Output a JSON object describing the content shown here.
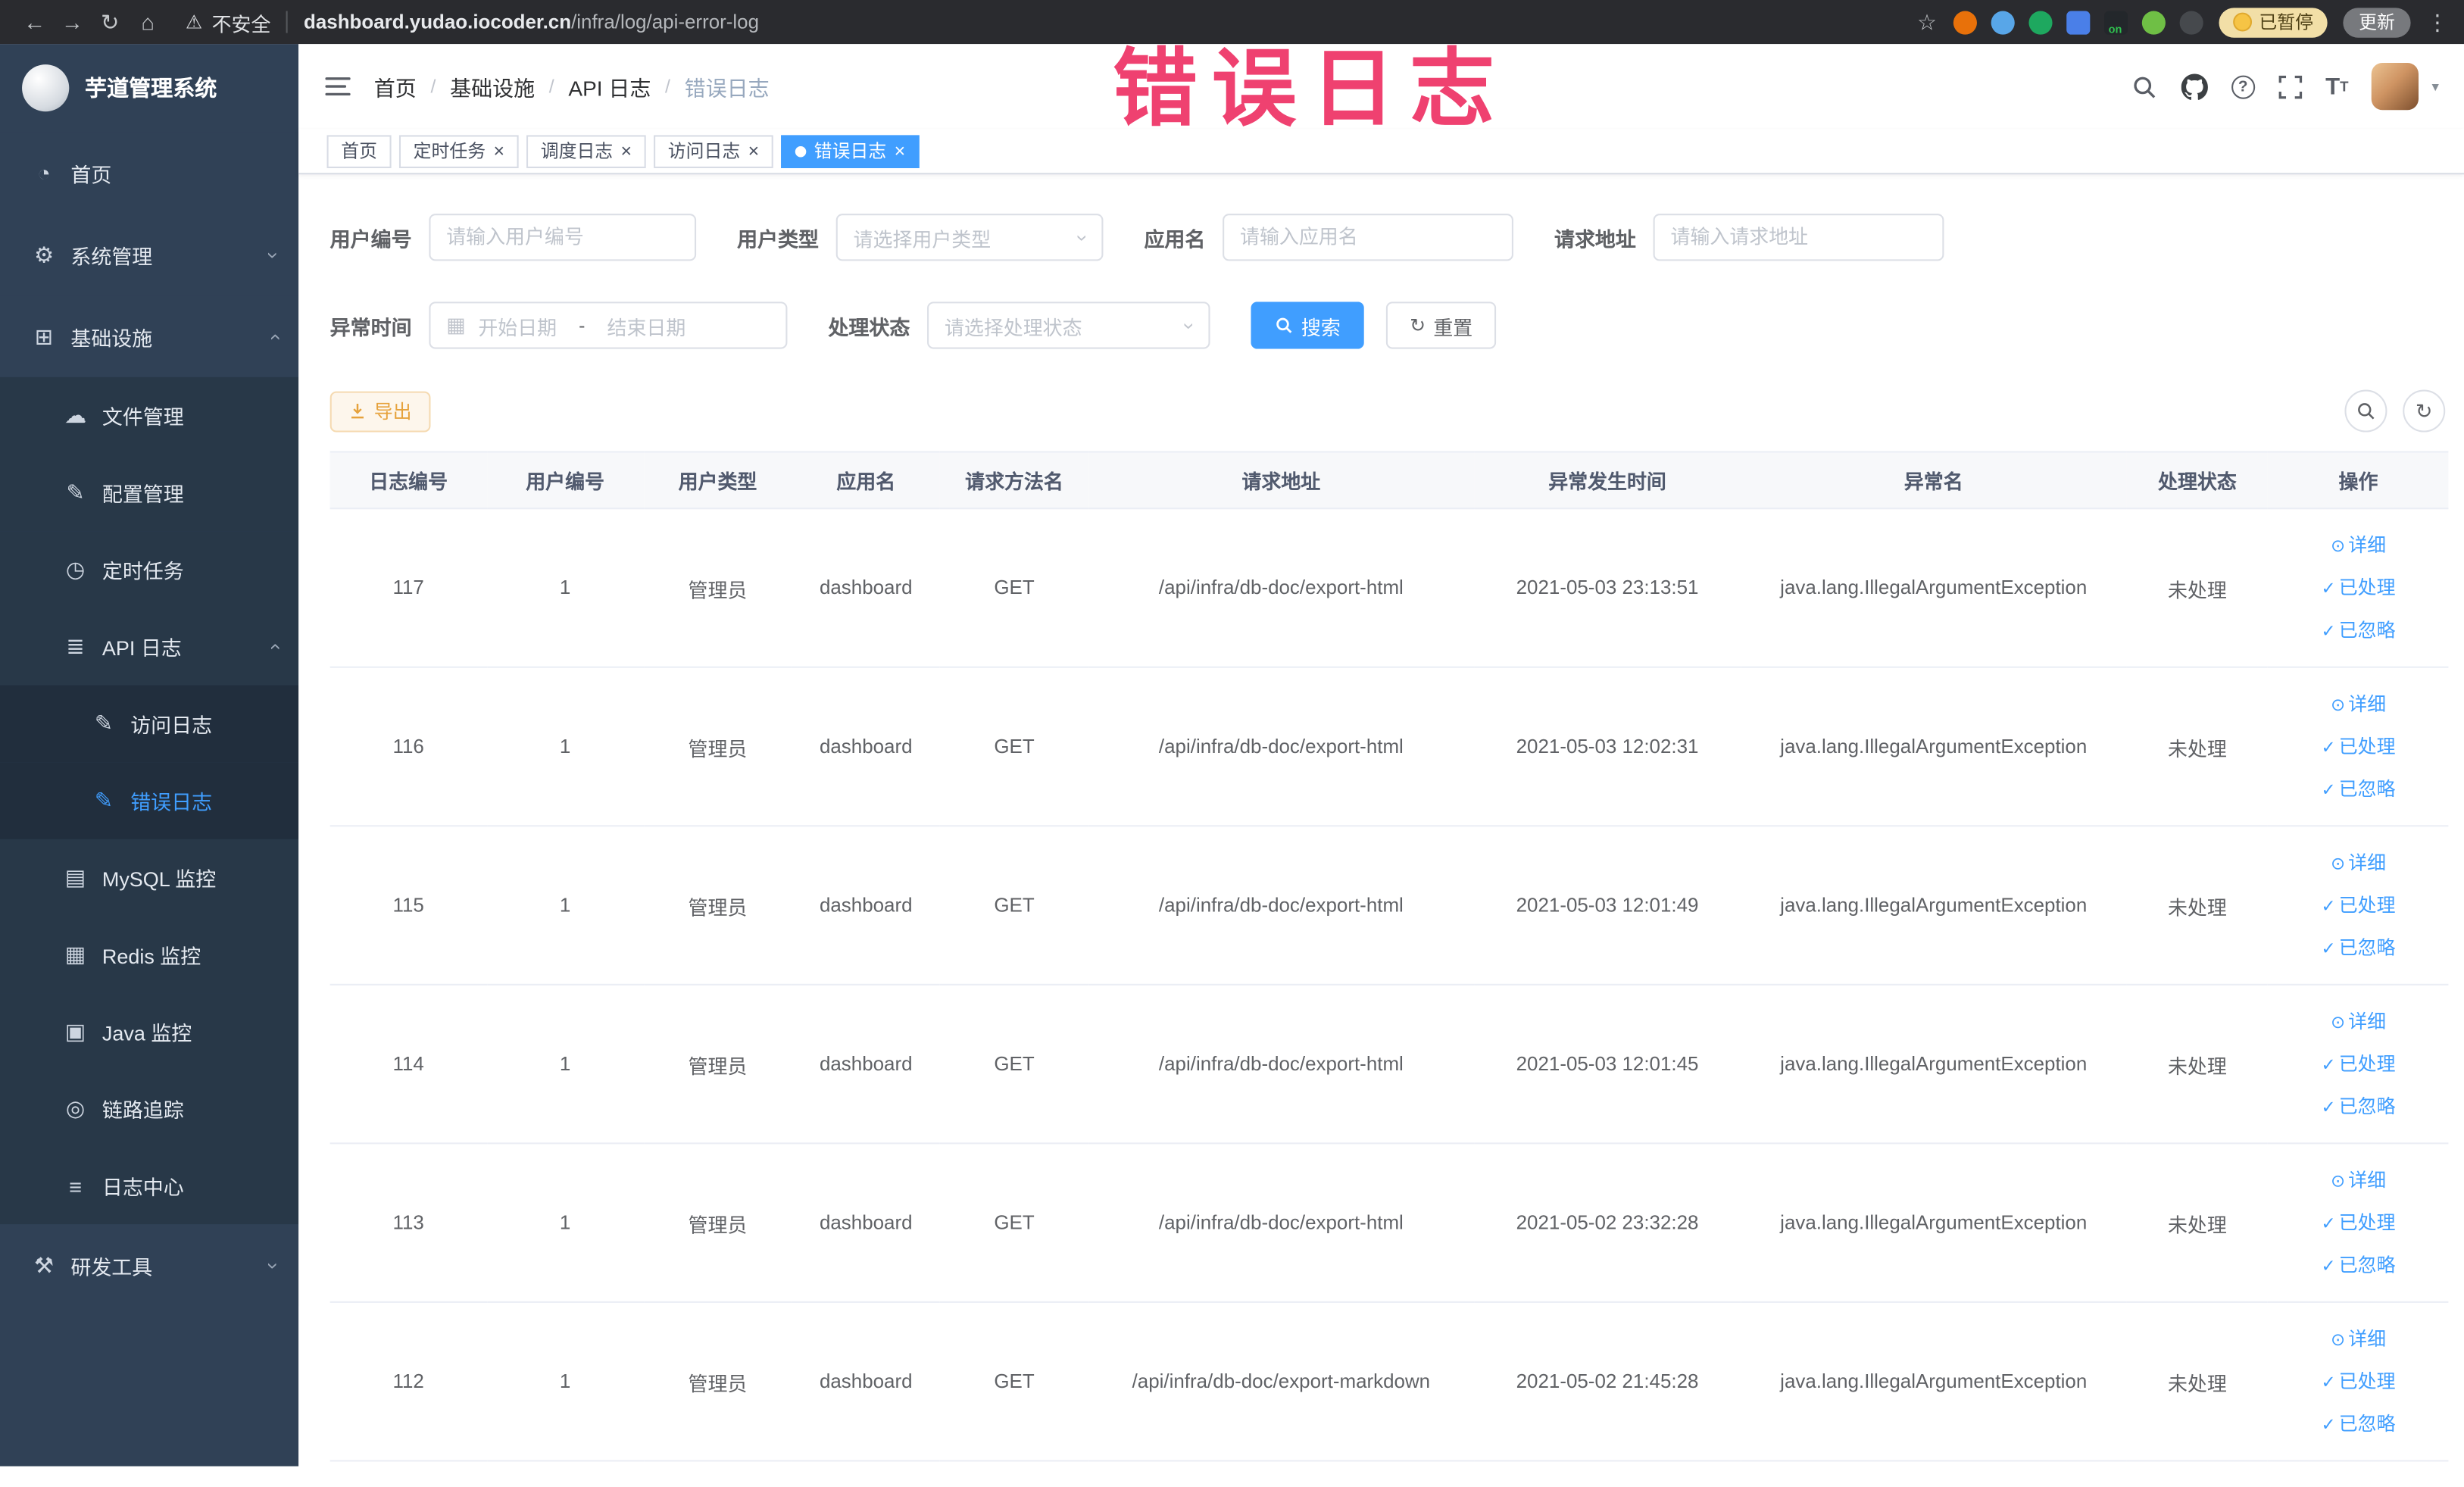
{
  "colors": {
    "accent": "#409eff",
    "warning": "#e6a23c",
    "annotation": "#ef4170"
  },
  "browser": {
    "security_label": "不安全",
    "url_host": "dashboard.yudao.iocoder.cn",
    "url_path": "/infra/log/api-error-log",
    "paused_badge": "已暂停",
    "update_button": "更新",
    "extensions": [
      {
        "name": "orange-ball-extension-icon",
        "color": "#e8710a",
        "shape": "circle"
      },
      {
        "name": "blue-drop-extension-icon",
        "color": "#58a6e8",
        "shape": "circle"
      },
      {
        "name": "green-check-extension-icon",
        "color": "#1ea85f",
        "shape": "circle"
      },
      {
        "name": "blue-grid-extension-icon",
        "color": "#4a7fe8",
        "shape": "square"
      },
      {
        "name": "proxy-on-extension-icon",
        "color": "#23272b",
        "shape": "square",
        "badge": "on",
        "badge_color": "#30c04f"
      },
      {
        "name": "green-leaf-extension-icon",
        "color": "#6fbf45",
        "shape": "circle"
      },
      {
        "name": "dark-paw-extension-icon",
        "color": "#46494d",
        "shape": "circle"
      }
    ]
  },
  "annotation": {
    "text": "错误日志"
  },
  "sidebar": {
    "logo_title": "芋道管理系统",
    "items": [
      {
        "key": "home",
        "label": "首页",
        "icon": "dashboard-icon",
        "level": 1
      },
      {
        "key": "system-management",
        "label": "系统管理",
        "icon": "gear-icon",
        "level": 1,
        "expand": "down"
      },
      {
        "key": "infrastructure",
        "label": "基础设施",
        "icon": "infra-icon",
        "level": 1,
        "expand": "up"
      },
      {
        "key": "file-management",
        "label": "文件管理",
        "icon": "file-icon",
        "level": 2
      },
      {
        "key": "config-management",
        "label": "配置管理",
        "icon": "config-icon",
        "level": 2
      },
      {
        "key": "scheduled-jobs",
        "label": "定时任务",
        "icon": "timer-icon",
        "level": 2
      },
      {
        "key": "api-logs",
        "label": "API 日志",
        "icon": "api-log-icon",
        "level": 2,
        "expand": "up"
      },
      {
        "key": "access-logs",
        "label": "访问日志",
        "icon": "edit-doc-icon",
        "level": 3
      },
      {
        "key": "error-logs",
        "label": "错误日志",
        "icon": "edit-doc-icon",
        "level": 3,
        "active": true
      },
      {
        "key": "mysql-monitor",
        "label": "MySQL 监控",
        "icon": "mysql-icon",
        "level": 2
      },
      {
        "key": "redis-monitor",
        "label": "Redis 监控",
        "icon": "redis-icon",
        "level": 2
      },
      {
        "key": "java-monitor",
        "label": "Java 监控",
        "icon": "java-icon",
        "level": 2
      },
      {
        "key": "trace",
        "label": "链路追踪",
        "icon": "eye-icon",
        "level": 2
      },
      {
        "key": "log-center",
        "label": "日志中心",
        "icon": "doc-icon",
        "level": 2
      },
      {
        "key": "dev-tools",
        "label": "研发工具",
        "icon": "tools-icon",
        "level": 1,
        "expand": "down"
      }
    ]
  },
  "header": {
    "breadcrumb": [
      "首页",
      "基础设施",
      "API 日志",
      "错误日志"
    ]
  },
  "tabs": [
    {
      "key": "home",
      "label": "首页",
      "closable": false,
      "active": false
    },
    {
      "key": "scheduled-jobs",
      "label": "定时任务",
      "closable": true,
      "active": false
    },
    {
      "key": "schedule-log",
      "label": "调度日志",
      "closable": true,
      "active": false
    },
    {
      "key": "access-log",
      "label": "访问日志",
      "closable": true,
      "active": false
    },
    {
      "key": "error-log",
      "label": "错误日志",
      "closable": true,
      "active": true
    }
  ],
  "filters": {
    "user_id": {
      "label": "用户编号",
      "placeholder": "请输入用户编号"
    },
    "user_type": {
      "label": "用户类型",
      "placeholder": "请选择用户类型"
    },
    "app_name": {
      "label": "应用名",
      "placeholder": "请输入应用名"
    },
    "request_url": {
      "label": "请求地址",
      "placeholder": "请输入请求地址"
    },
    "exception_time": {
      "label": "异常时间",
      "start_placeholder": "开始日期",
      "separator": "-",
      "end_placeholder": "结束日期"
    },
    "process_status": {
      "label": "处理状态",
      "placeholder": "请选择处理状态"
    },
    "search_label": "搜索",
    "reset_label": "重置"
  },
  "toolbar": {
    "export_label": "导出"
  },
  "table": {
    "columns": [
      {
        "key": "log-id",
        "label": "日志编号"
      },
      {
        "key": "user-id",
        "label": "用户编号"
      },
      {
        "key": "user-type",
        "label": "用户类型"
      },
      {
        "key": "app-name",
        "label": "应用名"
      },
      {
        "key": "method",
        "label": "请求方法名"
      },
      {
        "key": "url",
        "label": "请求地址"
      },
      {
        "key": "time",
        "label": "异常发生时间"
      },
      {
        "key": "exception",
        "label": "异常名"
      },
      {
        "key": "status",
        "label": "处理状态"
      },
      {
        "key": "actions",
        "label": "操作"
      }
    ],
    "row_actions": [
      {
        "key": "detail",
        "label": "详细",
        "icon": "view-icon"
      },
      {
        "key": "processed",
        "label": "已处理",
        "icon": "check-icon"
      },
      {
        "key": "ignored",
        "label": "已忽略",
        "icon": "check-icon"
      }
    ],
    "rows": [
      {
        "id": "117",
        "user_id": "1",
        "user_type": "管理员",
        "app_name": "dashboard",
        "method": "GET",
        "url": "/api/infra/db-doc/export-html",
        "time": "2021-05-03 23:13:51",
        "exception": "java.lang.IllegalArgumentException",
        "status": "未处理"
      },
      {
        "id": "116",
        "user_id": "1",
        "user_type": "管理员",
        "app_name": "dashboard",
        "method": "GET",
        "url": "/api/infra/db-doc/export-html",
        "time": "2021-05-03 12:02:31",
        "exception": "java.lang.IllegalArgumentException",
        "status": "未处理"
      },
      {
        "id": "115",
        "user_id": "1",
        "user_type": "管理员",
        "app_name": "dashboard",
        "method": "GET",
        "url": "/api/infra/db-doc/export-html",
        "time": "2021-05-03 12:01:49",
        "exception": "java.lang.IllegalArgumentException",
        "status": "未处理"
      },
      {
        "id": "114",
        "user_id": "1",
        "user_type": "管理员",
        "app_name": "dashboard",
        "method": "GET",
        "url": "/api/infra/db-doc/export-html",
        "time": "2021-05-03 12:01:45",
        "exception": "java.lang.IllegalArgumentException",
        "status": "未处理"
      },
      {
        "id": "113",
        "user_id": "1",
        "user_type": "管理员",
        "app_name": "dashboard",
        "method": "GET",
        "url": "/api/infra/db-doc/export-html",
        "time": "2021-05-02 23:32:28",
        "exception": "java.lang.IllegalArgumentException",
        "status": "未处理"
      },
      {
        "id": "112",
        "user_id": "1",
        "user_type": "管理员",
        "app_name": "dashboard",
        "method": "GET",
        "url": "/api/infra/db-doc/export-markdown",
        "time": "2021-05-02 21:45:28",
        "exception": "java.lang.IllegalArgumentException",
        "status": "未处理"
      }
    ]
  }
}
